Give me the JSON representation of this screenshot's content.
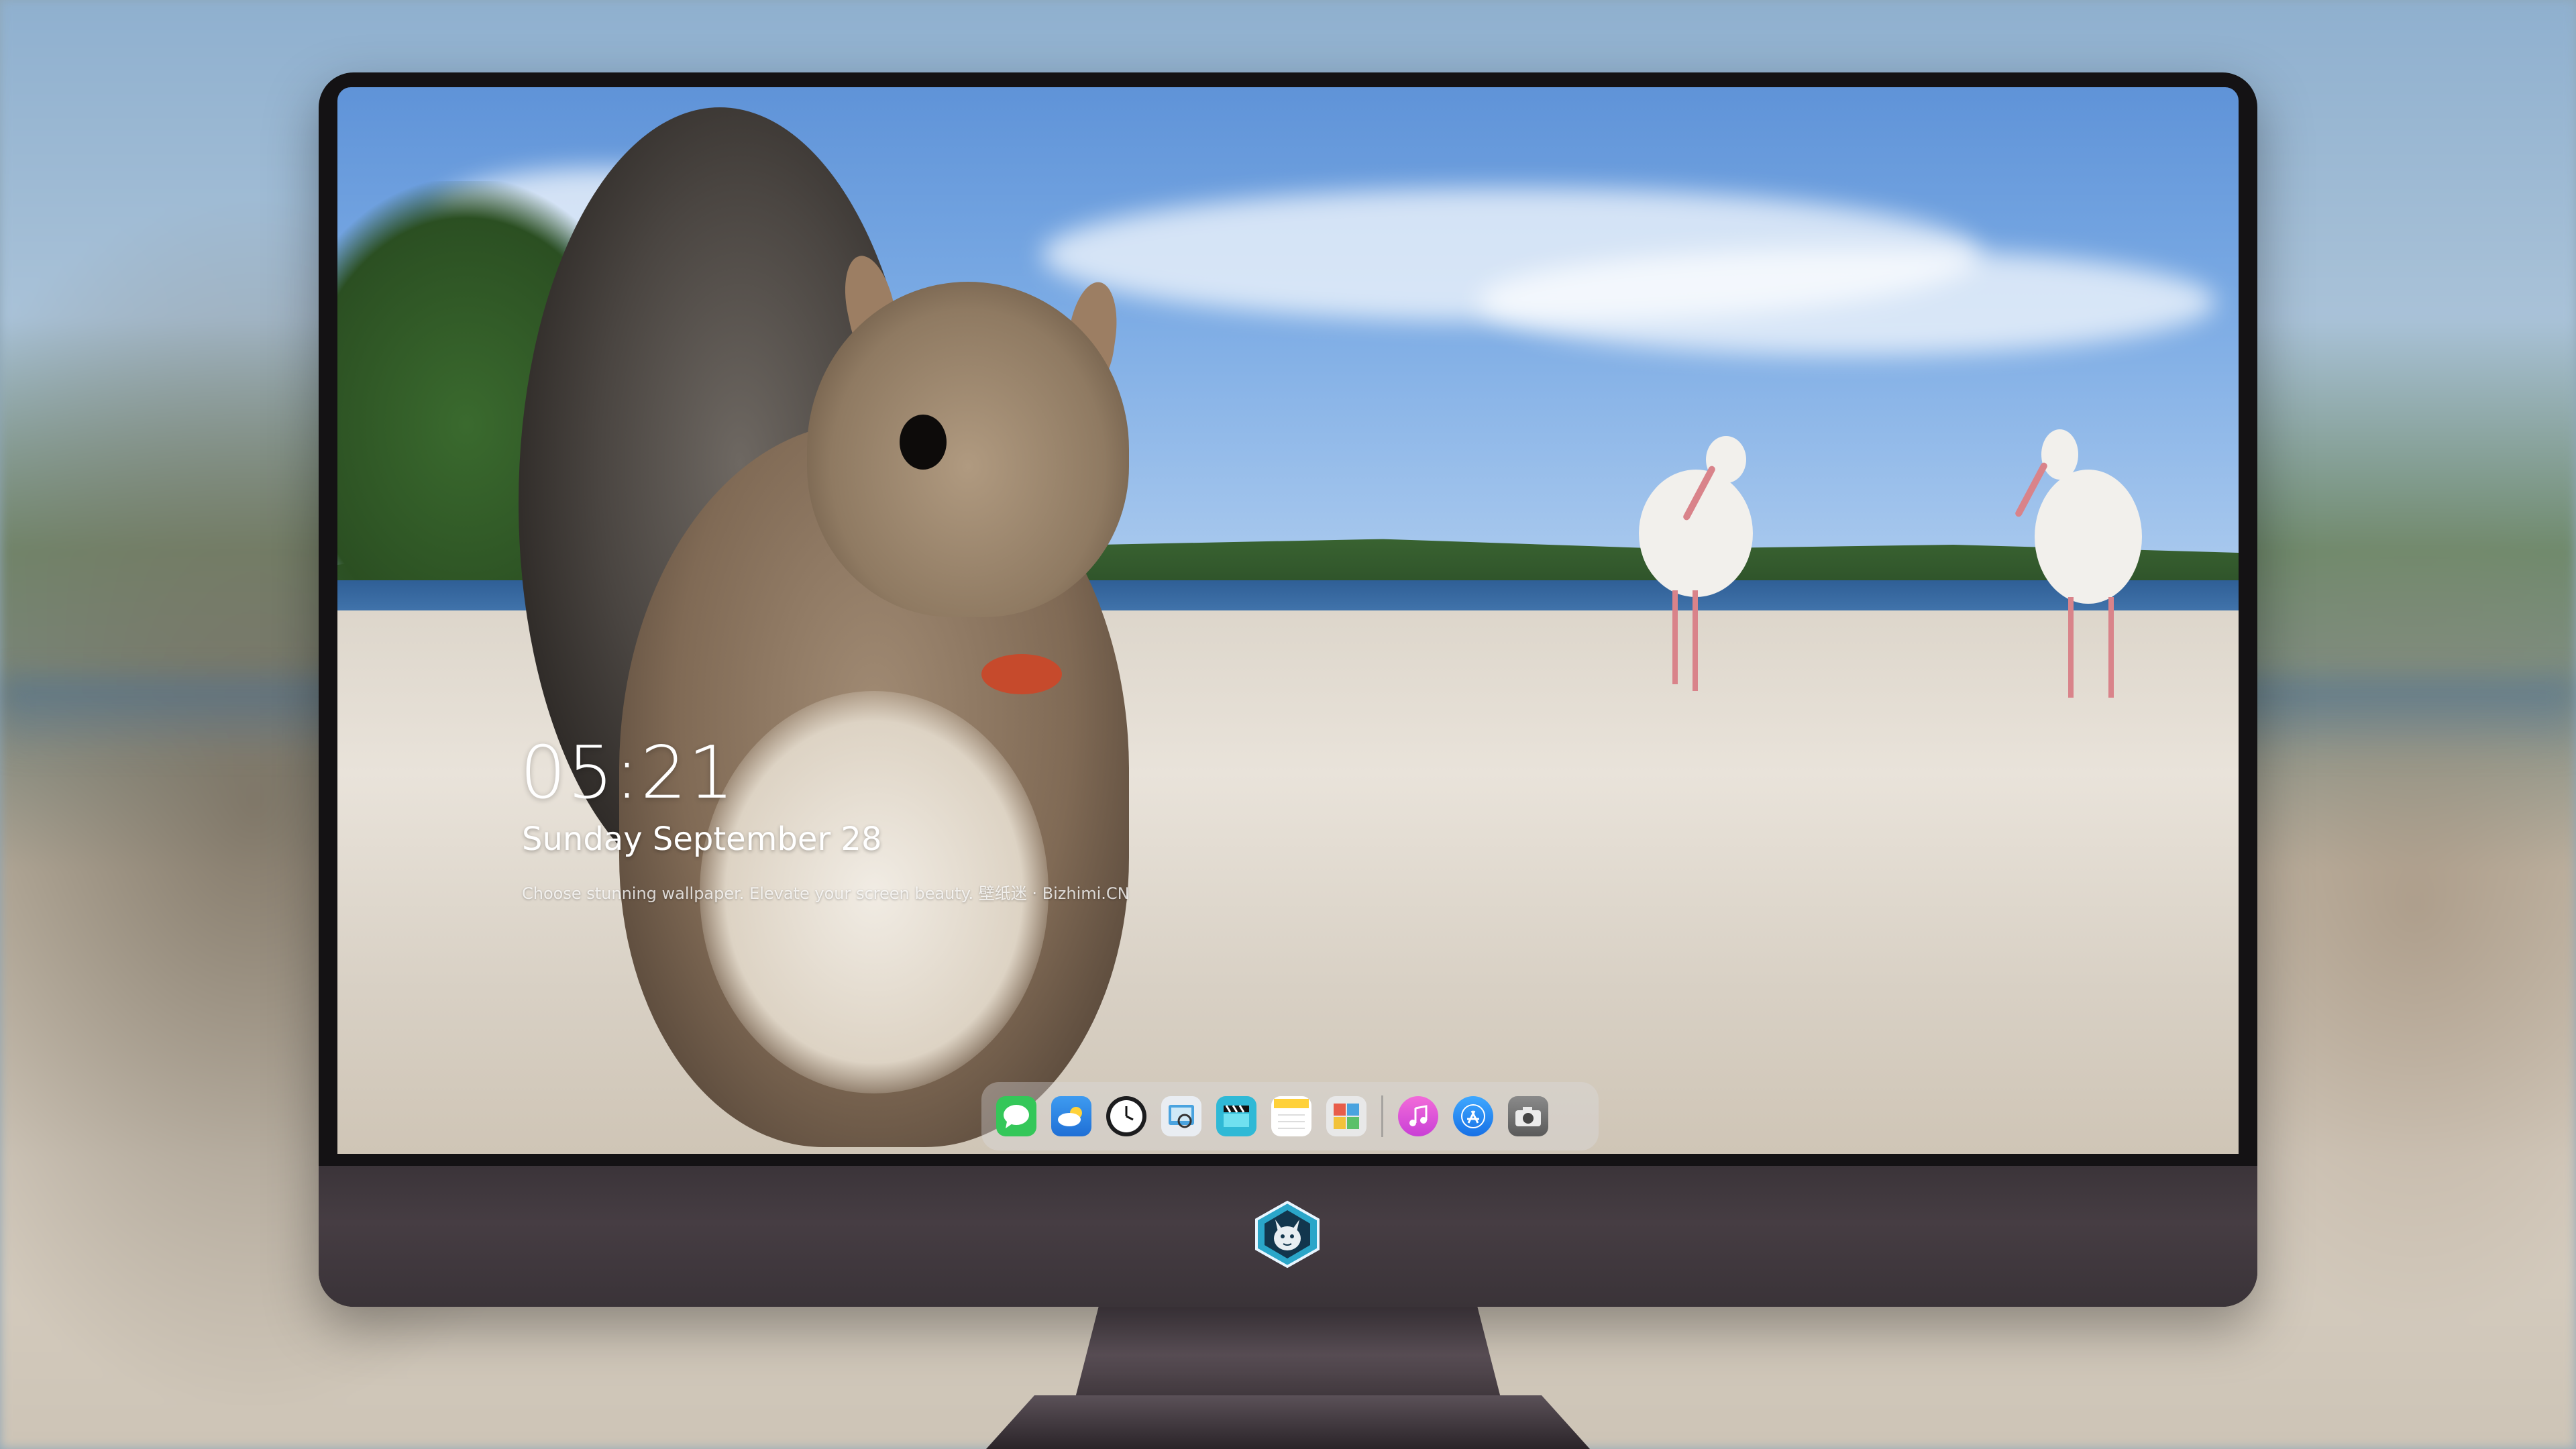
{
  "lockscreen": {
    "time": "05:21",
    "date": "Sunday September  28",
    "tagline": "Choose stunning wallpaper. Elevate your screen beauty. 壁纸迷 · Bizhimi.CN"
  },
  "dock": {
    "apps": [
      {
        "name": "Messages",
        "icon": "messages-icon",
        "color": "#34c759"
      },
      {
        "name": "Weather",
        "icon": "weather-icon",
        "color": "#2f86e6"
      },
      {
        "name": "Clock",
        "icon": "clock-icon",
        "color": "#1c1c1e"
      },
      {
        "name": "Preview",
        "icon": "preview-icon",
        "color": "#e9edf2"
      },
      {
        "name": "Clips",
        "icon": "clips-icon",
        "color": "#2fb9d6"
      },
      {
        "name": "Notes",
        "icon": "notes-icon",
        "color": "#ffd13a"
      },
      {
        "name": "Photo Booth",
        "icon": "photo-booth-icon",
        "color": "#e8e8e8"
      },
      {
        "name": "iTunes",
        "icon": "itunes-icon",
        "color": "#e64bd2"
      },
      {
        "name": "App Store",
        "icon": "app-store-icon",
        "color": "#1e8cf5"
      },
      {
        "name": "Screenshot",
        "icon": "camera-icon",
        "color": "#7a7a7a"
      }
    ]
  },
  "monitor": {
    "logo": "wolf-mascot-logo",
    "bezel_color": "#141214",
    "chin_color": "#3f383d"
  }
}
